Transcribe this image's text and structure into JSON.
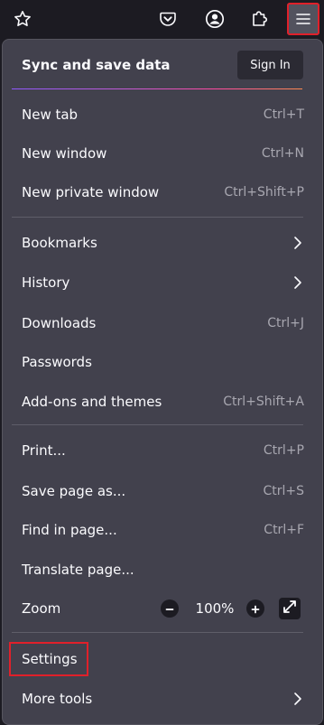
{
  "toolbar": {
    "bookmark_icon": "star-icon",
    "pocket_icon": "pocket-icon",
    "account_icon": "account-icon",
    "extensions_icon": "puzzle-icon",
    "menu_icon": "hamburger-icon"
  },
  "sync": {
    "title": "Sync and save data",
    "signin_label": "Sign In"
  },
  "menu": {
    "new_tab": {
      "label": "New tab",
      "shortcut": "Ctrl+T"
    },
    "new_window": {
      "label": "New window",
      "shortcut": "Ctrl+N"
    },
    "new_private_window": {
      "label": "New private window",
      "shortcut": "Ctrl+Shift+P"
    },
    "bookmarks": {
      "label": "Bookmarks"
    },
    "history": {
      "label": "History"
    },
    "downloads": {
      "label": "Downloads",
      "shortcut": "Ctrl+J"
    },
    "passwords": {
      "label": "Passwords"
    },
    "addons": {
      "label": "Add-ons and themes",
      "shortcut": "Ctrl+Shift+A"
    },
    "print": {
      "label": "Print...",
      "shortcut": "Ctrl+P"
    },
    "save_page": {
      "label": "Save page as...",
      "shortcut": "Ctrl+S"
    },
    "find": {
      "label": "Find in page...",
      "shortcut": "Ctrl+F"
    },
    "translate": {
      "label": "Translate page..."
    },
    "zoom": {
      "label": "Zoom",
      "value": "100%"
    },
    "settings": {
      "label": "Settings"
    },
    "more_tools": {
      "label": "More tools"
    }
  },
  "colors": {
    "panel_bg": "#42414d",
    "toolbar_bg": "#1c1b22",
    "text": "#fbfbfe",
    "shortcut_text": "#a8a7b0",
    "highlight": "#e0202a"
  }
}
